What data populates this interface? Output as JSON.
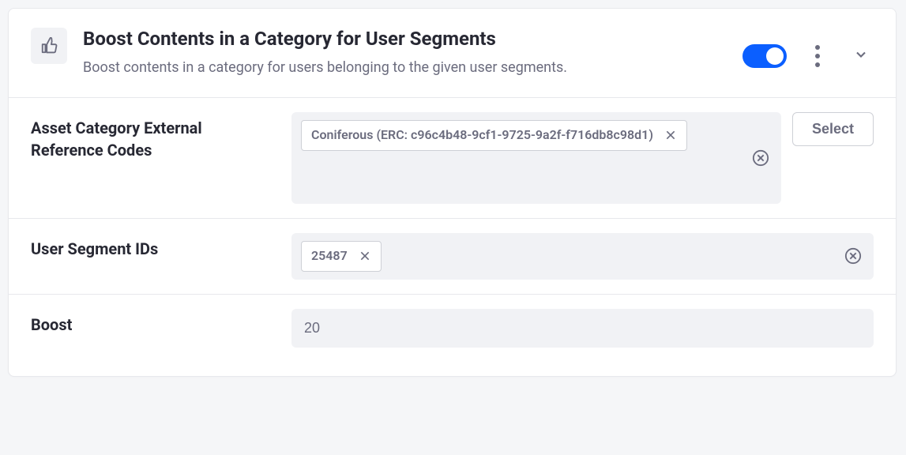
{
  "header": {
    "title": "Boost Contents in a Category for User Segments",
    "description": "Boost contents in a category for users belonging to the given user segments.",
    "enabled": true
  },
  "fields": {
    "categories": {
      "label": "Asset Category External Reference Codes",
      "tags": [
        {
          "text": "Coniferous (ERC: c96c4b48-9cf1-9725-9a2f-f716db8c98d1)"
        }
      ],
      "select_label": "Select"
    },
    "segments": {
      "label": "User Segment IDs",
      "tags": [
        {
          "text": "25487"
        }
      ]
    },
    "boost": {
      "label": "Boost",
      "value": "20"
    }
  }
}
